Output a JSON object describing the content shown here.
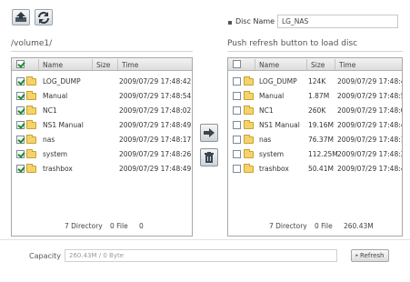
{
  "toolbar": {
    "upload_icon": "upload-icon",
    "sync_icon": "sync-icon"
  },
  "disc": {
    "label": "Disc Name",
    "value": "LG_NAS"
  },
  "left": {
    "path": "/volume1/",
    "columns": [
      "Name",
      "Size",
      "Time"
    ],
    "rows": [
      {
        "name": "LOG_DUMP",
        "size": "",
        "time": "2009/07/29 17:48:42",
        "checked": true
      },
      {
        "name": "Manual",
        "size": "",
        "time": "2009/07/29 17:48:54",
        "checked": true
      },
      {
        "name": "NC1",
        "size": "",
        "time": "2009/07/29 17:48:02",
        "checked": true
      },
      {
        "name": "NS1 Manual",
        "size": "",
        "time": "2009/07/29 17:48:49",
        "checked": true
      },
      {
        "name": "nas",
        "size": "",
        "time": "2009/07/29 17:48:17",
        "checked": true
      },
      {
        "name": "system",
        "size": "",
        "time": "2009/07/29 17:48:26",
        "checked": true
      },
      {
        "name": "trashbox",
        "size": "",
        "time": "2009/07/29 17:48:49",
        "checked": true
      }
    ],
    "footer": {
      "dirs": "7 Directory",
      "files": "0 File",
      "size": "0"
    }
  },
  "right": {
    "path": "Push refresh button to load disc",
    "columns": [
      "Name",
      "Size",
      "Time"
    ],
    "rows": [
      {
        "name": "LOG_DUMP",
        "size": "124K",
        "time": "2009/07/29 17:48:42",
        "checked": false
      },
      {
        "name": "Manual",
        "size": "1.87M",
        "time": "2009/07/29 17:48:54",
        "checked": false
      },
      {
        "name": "NC1",
        "size": "260K",
        "time": "2009/07/29 17:48:02",
        "checked": false
      },
      {
        "name": "NS1 Manual",
        "size": "19.16M",
        "time": "2009/07/29 17:48:49",
        "checked": false
      },
      {
        "name": "nas",
        "size": "76.37M",
        "time": "2009/07/29 17:48:17",
        "checked": false
      },
      {
        "name": "system",
        "size": "112.25M",
        "time": "2009/07/29 17:48:26",
        "checked": false
      },
      {
        "name": "trashbox",
        "size": "50.41M",
        "time": "2009/07/29 17:48:49",
        "checked": false
      }
    ],
    "footer": {
      "dirs": "7 Directory",
      "files": "0 File",
      "size": "260.43M"
    }
  },
  "actions": {
    "copy_icon": "arrow-right-icon",
    "delete_icon": "trash-icon"
  },
  "capacity": {
    "label": "Capacity",
    "value": "260.43M / 0 Byte"
  },
  "refresh_label": "Refresh"
}
